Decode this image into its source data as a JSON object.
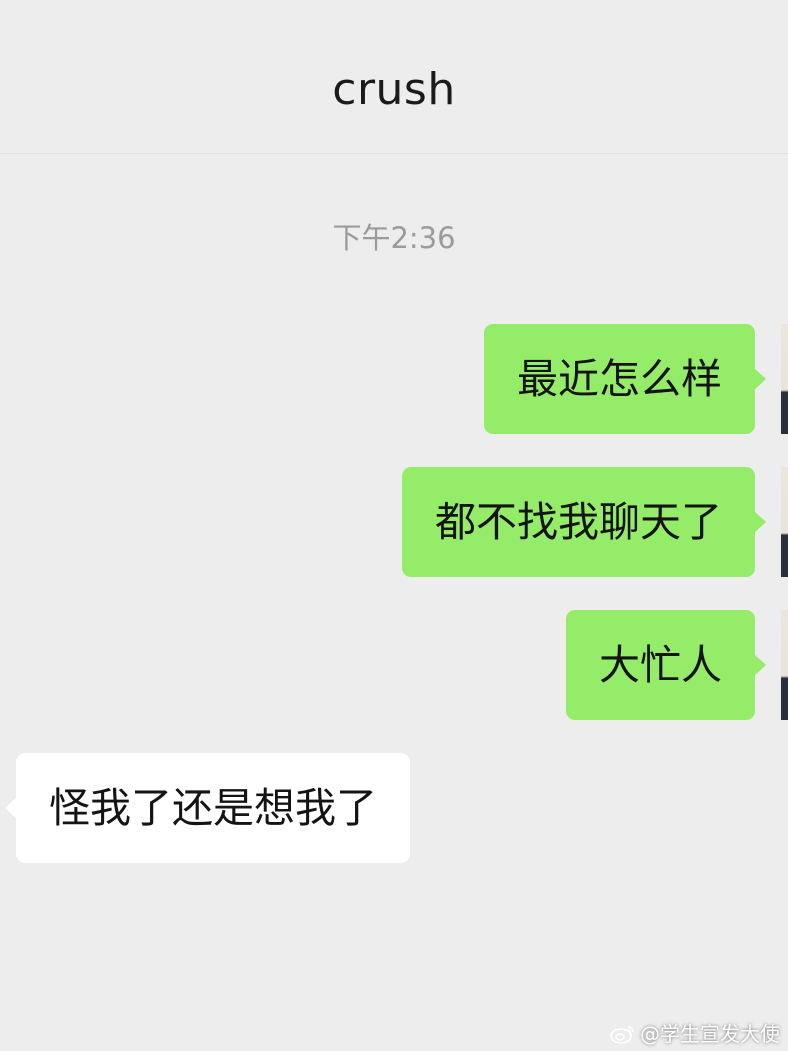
{
  "header": {
    "title": "crush"
  },
  "chat": {
    "timestamp": "下午2:36",
    "messages": [
      {
        "side": "sent",
        "text": "最近怎么样"
      },
      {
        "side": "sent",
        "text": "都不找我聊天了"
      },
      {
        "side": "sent",
        "text": "大忙人"
      },
      {
        "side": "received",
        "text": "怪我了还是想我了"
      }
    ]
  },
  "watermark": {
    "text": "@学生宣发大使",
    "icon": "weibo-logo-icon"
  },
  "colors": {
    "background": "#ededed",
    "sent_bubble": "#95ec69",
    "received_bubble": "#ffffff",
    "timestamp": "#9b9b9b"
  }
}
